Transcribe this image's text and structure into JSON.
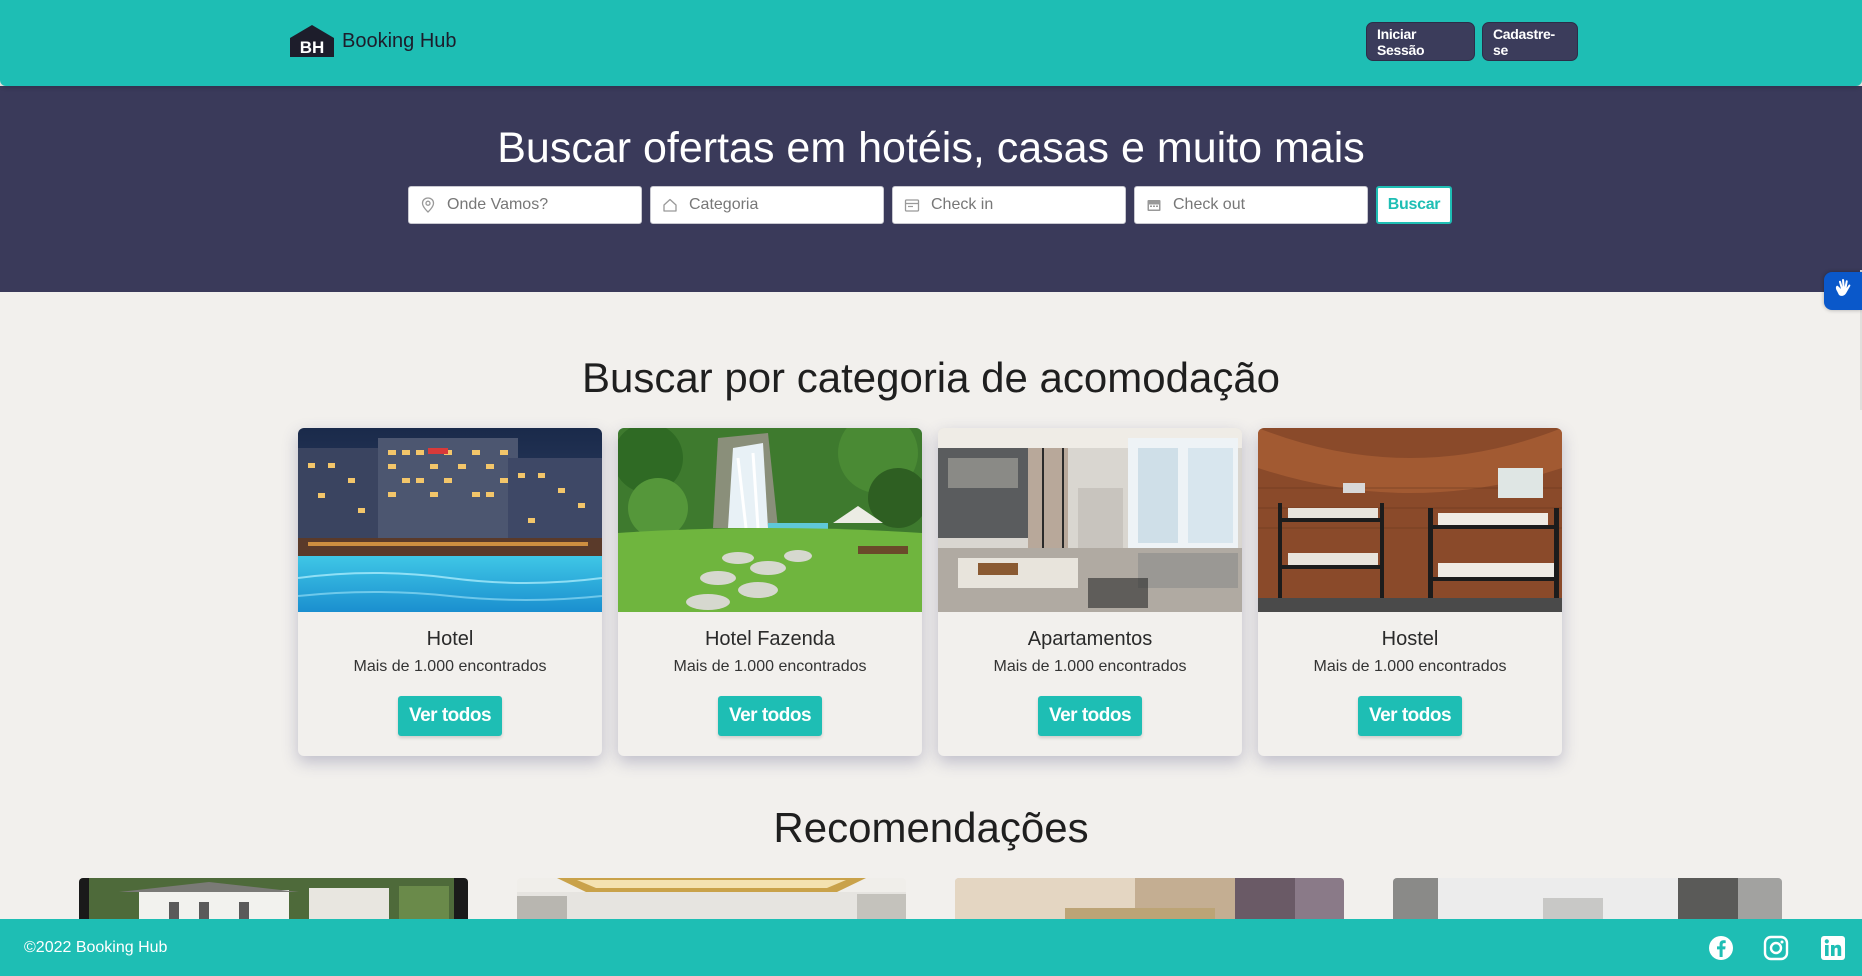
{
  "header": {
    "logo_mark": "BH",
    "brand": "Booking Hub",
    "login_label": "Iniciar Sessão",
    "signup_label": "Cadastre-se"
  },
  "hero": {
    "title": "Buscar ofertas em hotéis, casas e muito mais",
    "fields": [
      {
        "placeholder": "Onde Vamos?",
        "icon": "location-pin-icon"
      },
      {
        "placeholder": "Categoria",
        "icon": "house-icon"
      },
      {
        "placeholder": "Check in",
        "icon": "calendar-icon"
      },
      {
        "placeholder": "Check out",
        "icon": "calendar-icon"
      }
    ],
    "search_label": "Buscar"
  },
  "categories": {
    "title": "Buscar por categoria de acomodação",
    "items": [
      {
        "name": "Hotel",
        "count": "Mais de 1.000 encontrados",
        "button": "Ver todos"
      },
      {
        "name": "Hotel Fazenda",
        "count": "Mais de 1.000 encontrados",
        "button": "Ver todos"
      },
      {
        "name": "Apartamentos",
        "count": "Mais de 1.000 encontrados",
        "button": "Ver todos"
      },
      {
        "name": "Hostel",
        "count": "Mais de 1.000 encontrados",
        "button": "Ver todos"
      }
    ]
  },
  "recommendations": {
    "title": "Recomendações"
  },
  "footer": {
    "copyright": "©2022 Booking Hub",
    "social": [
      "facebook-icon",
      "instagram-icon",
      "linkedin-icon"
    ]
  },
  "colors": {
    "teal": "#1ebeb4",
    "navy": "#3a3a5a",
    "background": "#f2f0ed"
  }
}
